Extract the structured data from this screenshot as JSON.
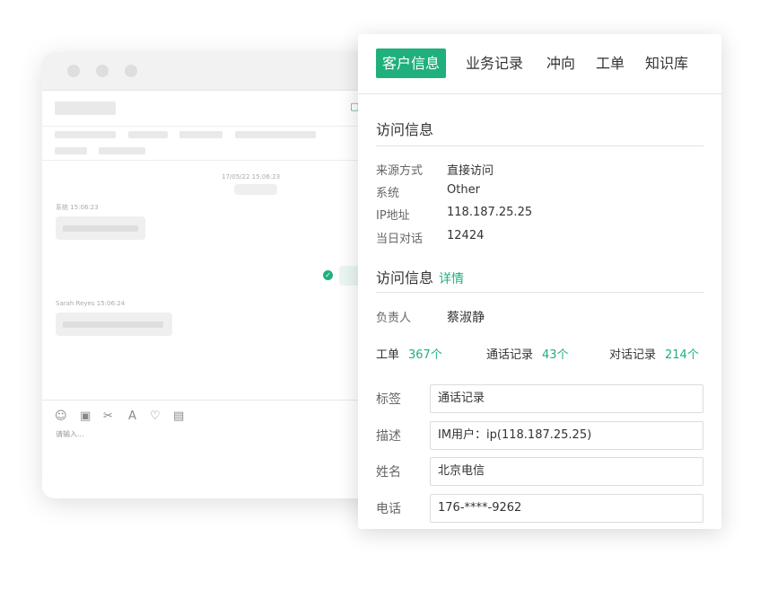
{
  "chat": {
    "timestamp": "17/05/22 15:06:23",
    "msg1_meta": "系统 15:06:23",
    "msg2_meta": "Sarah Reyes 15:06:24",
    "input_placeholder": "请输入..."
  },
  "panel": {
    "tabs": [
      {
        "label": "客户信息",
        "active": true
      },
      {
        "label": "业务记录",
        "active": false
      },
      {
        "label": "冲向",
        "active": false
      },
      {
        "label": "工单",
        "active": false
      },
      {
        "label": "知识库",
        "active": false
      }
    ],
    "visit_section_title": "访问信息",
    "visit_info": [
      {
        "label": "来源方式",
        "value": "直接访问"
      },
      {
        "label": "系统",
        "value": "Other"
      },
      {
        "label": "IP地址",
        "value": "118.187.25.25"
      },
      {
        "label": "当日对话",
        "value": "12424"
      }
    ],
    "second_section_title": "访问信息",
    "detail_link": "详情",
    "owner_label": "负责人",
    "owner_value": "蔡淑静",
    "stats": [
      {
        "label": "工单",
        "count": "367个"
      },
      {
        "label": "通话记录",
        "count": "43个"
      },
      {
        "label": "对话记录",
        "count": "214个"
      }
    ],
    "form": [
      {
        "label": "标签",
        "value": "通话记录"
      },
      {
        "label": "描述",
        "value": "IM用户：ip(118.187.25.25)"
      },
      {
        "label": "姓名",
        "value": "北京电信"
      },
      {
        "label": "电话",
        "value": "176-****-9262"
      }
    ],
    "accent_color": "#1fb07c"
  }
}
